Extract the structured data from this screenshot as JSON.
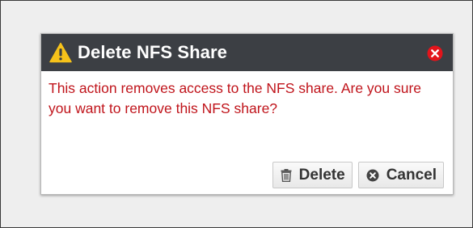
{
  "dialog": {
    "title": "Delete NFS Share",
    "title_icon": "warning-icon",
    "close_icon": "close-icon",
    "message": "This action removes access to the NFS share. Are you sure you want to remove this NFS share?",
    "buttons": {
      "delete_label": "Delete",
      "delete_icon": "trash-icon",
      "cancel_label": "Cancel",
      "cancel_icon": "cancel-circle-icon"
    }
  },
  "colors": {
    "titlebar_bg": "#3c3f44",
    "title_text": "#ffffff",
    "message_text": "#c0141b",
    "warning_icon": "#f6c21a",
    "close_icon": "#e3141b"
  }
}
